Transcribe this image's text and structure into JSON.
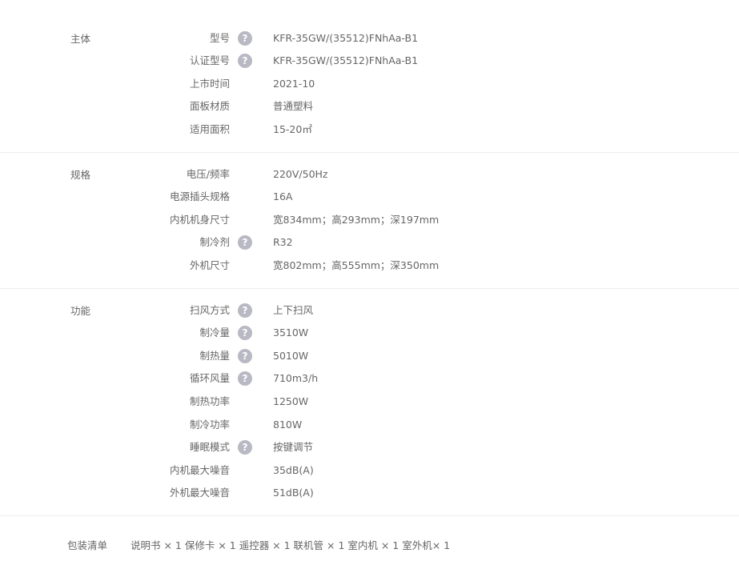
{
  "sections": [
    {
      "title": "主体",
      "rows": [
        {
          "label": "型号",
          "help": true,
          "value": "KFR-35GW/(35512)FNhAa-B1"
        },
        {
          "label": "认证型号",
          "help": true,
          "value": "KFR-35GW/(35512)FNhAa-B1"
        },
        {
          "label": "上市时间",
          "help": false,
          "value": "2021-10"
        },
        {
          "label": "面板材质",
          "help": false,
          "value": "普通塑料"
        },
        {
          "label": "适用面积",
          "help": false,
          "value": "15-20㎡"
        }
      ]
    },
    {
      "title": "规格",
      "rows": [
        {
          "label": "电压/频率",
          "help": false,
          "value": "220V/50Hz"
        },
        {
          "label": "电源插头规格",
          "help": false,
          "value": "16A"
        },
        {
          "label": "内机机身尺寸",
          "help": false,
          "value": "宽834mm；高293mm；深197mm"
        },
        {
          "label": "制冷剂",
          "help": true,
          "value": "R32"
        },
        {
          "label": "外机尺寸",
          "help": false,
          "value": "宽802mm；高555mm；深350mm"
        }
      ]
    },
    {
      "title": "功能",
      "rows": [
        {
          "label": "扫风方式",
          "help": true,
          "value": "上下扫风"
        },
        {
          "label": "制冷量",
          "help": true,
          "value": "3510W"
        },
        {
          "label": "制热量",
          "help": true,
          "value": "5010W"
        },
        {
          "label": "循环风量",
          "help": true,
          "value": "710m3/h"
        },
        {
          "label": "制热功率",
          "help": false,
          "value": "1250W"
        },
        {
          "label": "制冷功率",
          "help": false,
          "value": "810W"
        },
        {
          "label": "睡眠模式",
          "help": true,
          "value": "按键调节"
        },
        {
          "label": "内机最大噪音",
          "help": false,
          "value": "35dB(A)"
        },
        {
          "label": "外机最大噪音",
          "help": false,
          "value": "51dB(A)"
        }
      ]
    }
  ],
  "help_glyph": "?",
  "help_icon": "question-circle-icon",
  "help_color": "#b9b9c4",
  "package": {
    "label": "包装清单",
    "value": "说明书 × 1 保修卡 × 1 遥控器 × 1 联机管 × 1 室内机 × 1 室外机× 1"
  }
}
